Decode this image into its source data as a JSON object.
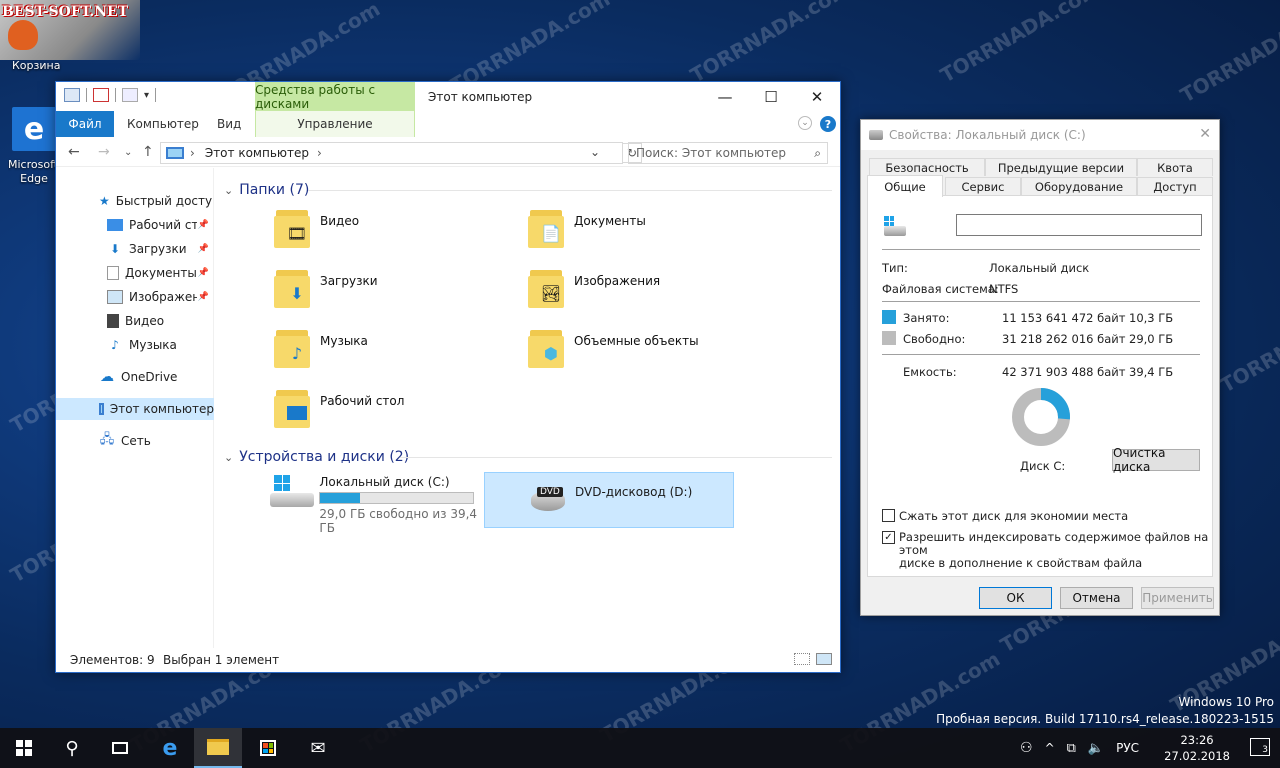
{
  "desktop": {
    "logo_text": "BEST-SOFT.NET",
    "recycle_bin": "Корзина",
    "edge_label_1": "Microsoft",
    "edge_label_2": "Edge",
    "watermark": "TORRNADA.com"
  },
  "explorer": {
    "title": "Этот компьютер",
    "context_tab": "Средства работы с дисками",
    "context_subtab": "Управление",
    "ribbon_tabs": [
      "Файл",
      "Компьютер",
      "Вид"
    ],
    "address": "Этот компьютер",
    "search_placeholder": "Поиск: Этот компьютер",
    "sidebar": {
      "quick_access": "Быстрый доступ",
      "items": [
        "Рабочий стол",
        "Загрузки",
        "Документы",
        "Изображения",
        "Видео",
        "Музыка"
      ],
      "onedrive": "OneDrive",
      "this_pc": "Этот компьютер",
      "network": "Сеть"
    },
    "folders_header": "Папки (7)",
    "folders": [
      "Видео",
      "Документы",
      "Загрузки",
      "Изображения",
      "Музыка",
      "Объемные объекты",
      "Рабочий стол"
    ],
    "drives_header": "Устройства и диски (2)",
    "drive_c": {
      "name": "Локальный диск (C:)",
      "free": "29,0 ГБ свободно из 39,4 ГБ",
      "used_fraction": 0.26
    },
    "drive_d": {
      "name": "DVD-дисковод (D:)",
      "badge": "DVD"
    },
    "status_items": "Элементов: 9",
    "status_selected": "Выбран 1 элемент"
  },
  "props": {
    "title": "Свойства: Локальный диск (C:)",
    "tabs_row1": [
      "Безопасность",
      "Предыдущие версии",
      "Квота"
    ],
    "tabs_row2": [
      "Общие",
      "Сервис",
      "Оборудование",
      "Доступ"
    ],
    "type_label": "Тип:",
    "type_value": "Локальный диск",
    "fs_label": "Файловая система:",
    "fs_value": "NTFS",
    "used_label": "Занято:",
    "used_bytes": "11 153 641 472 байт",
    "used_gb": "10,3 ГБ",
    "free_label": "Свободно:",
    "free_bytes": "31 218 262 016 байт",
    "free_gb": "29,0 ГБ",
    "capacity_label": "Емкость:",
    "capacity_bytes": "42 371 903 488 байт",
    "capacity_gb": "39,4 ГБ",
    "disk_label": "Диск C:",
    "cleanup_button": "Очистка диска",
    "compress_label": "Сжать этот диск для экономии места",
    "index_label_1": "Разрешить индексировать содержимое файлов на этом",
    "index_label_2": "диске в дополнение к свойствам файла",
    "ok": "ОК",
    "cancel": "Отмена",
    "apply": "Применить",
    "colors": {
      "used": "#26a0da",
      "free": "#bcbcbc"
    },
    "used_fraction": 0.263
  },
  "wininfo": {
    "line1": "Windows 10 Pro",
    "line2": "Пробная версия. Build 17110.rs4_release.180223-1515"
  },
  "taskbar": {
    "lang": "РУС",
    "time": "23:26",
    "date": "27.02.2018",
    "notifications": "3"
  }
}
